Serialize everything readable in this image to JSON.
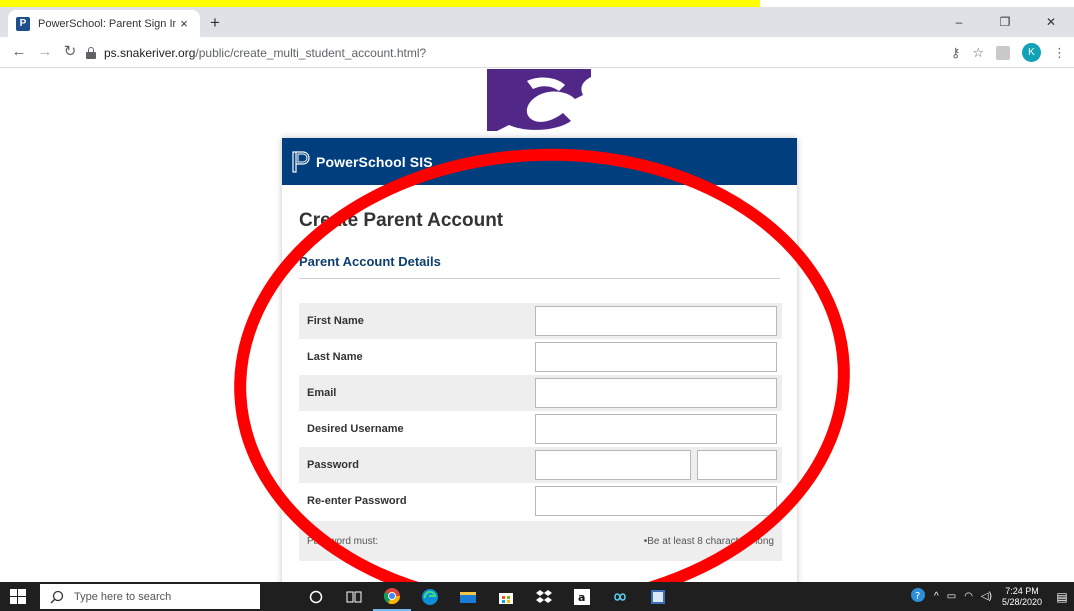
{
  "browser": {
    "tab_title": "PowerSchool: Parent Sign In",
    "tab_close": "×",
    "new_tab": "+",
    "url_host": "ps.snakeriver.org",
    "url_path": "/public/create_multi_student_account.html?",
    "profile_initial": "K",
    "win_min": "–",
    "win_restore": "❐",
    "win_close": "✕"
  },
  "page": {
    "header_title": "PowerSchool SIS",
    "page_title": "Create Parent Account",
    "section_title": "Parent Account Details",
    "fields": [
      {
        "label": "First Name",
        "value": ""
      },
      {
        "label": "Last Name",
        "value": ""
      },
      {
        "label": "Email",
        "value": ""
      },
      {
        "label": "Desired Username",
        "value": ""
      },
      {
        "label": "Password",
        "value": ""
      },
      {
        "label": "Re-enter Password",
        "value": ""
      }
    ],
    "password_rule_label": "Password must:",
    "password_rule_text": "•Be at least 8 characters long"
  },
  "taskbar": {
    "search_placeholder": "Type here to search",
    "time": "7:24 PM",
    "date": "5/28/2020"
  },
  "colors": {
    "header_bg": "#003e7e",
    "annotation": "#ff0000",
    "highlight": "#ffff00",
    "mascot": "#512888"
  }
}
